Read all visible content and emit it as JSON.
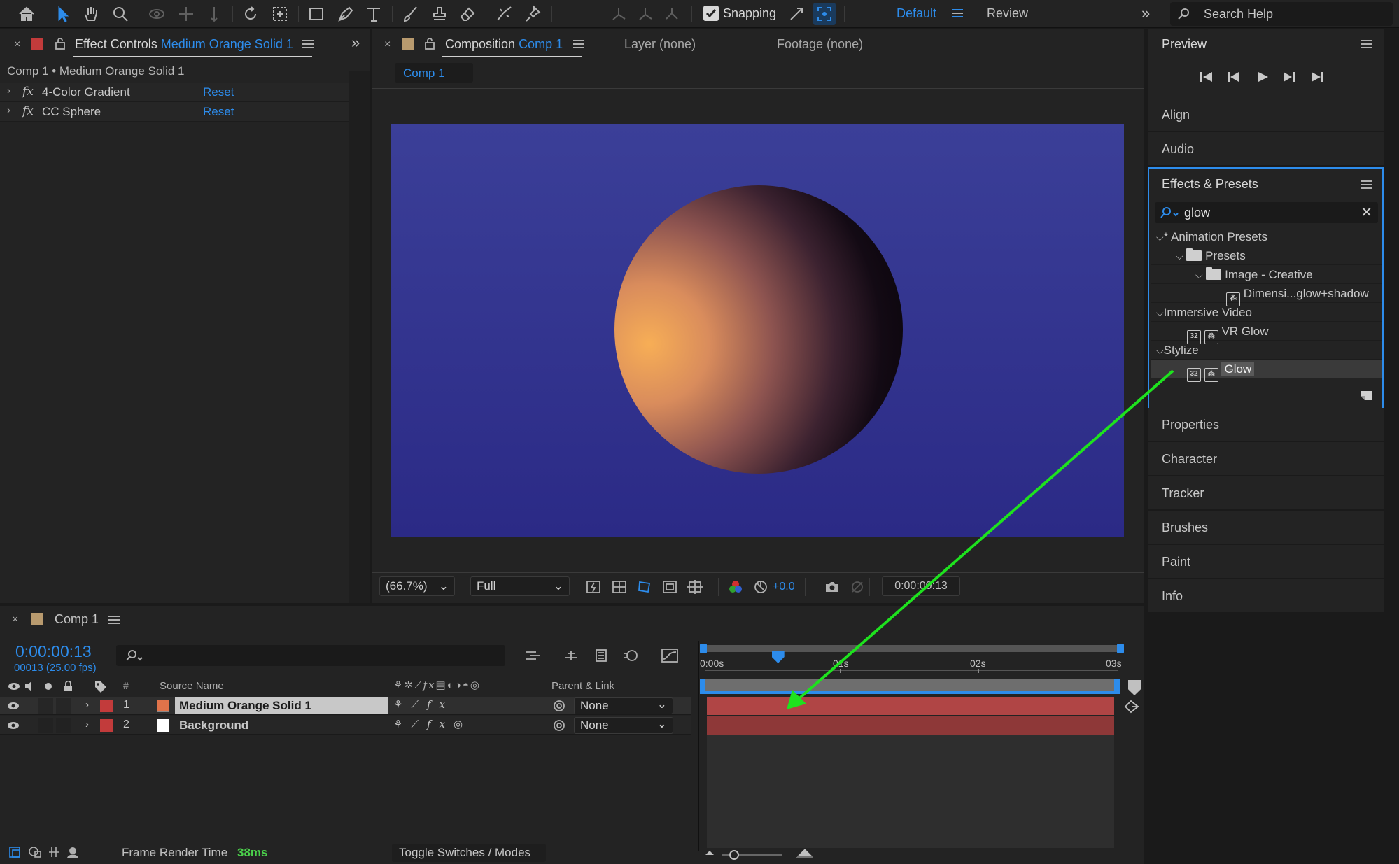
{
  "toolbar": {
    "snapping_label": "Snapping",
    "workspace_default": "Default",
    "workspace_review": "Review",
    "search_placeholder": "Search Help"
  },
  "effect_controls": {
    "tab_prefix": "Effect Controls",
    "tab_layer": "Medium Orange Solid 1",
    "breadcrumb": "Comp 1 • Medium Orange Solid 1",
    "effects": [
      {
        "name": "4-Color Gradient",
        "reset": "Reset"
      },
      {
        "name": "CC Sphere",
        "reset": "Reset"
      }
    ]
  },
  "composition": {
    "tab_prefix": "Composition",
    "tab_name": "Comp 1",
    "layer_tab": "Layer (none)",
    "footage_tab": "Footage (none)",
    "sub_tab": "Comp 1",
    "zoom": "(66.7%)",
    "resolution": "Full",
    "exposure": "+0.0",
    "timecode": "0:00:00:13",
    "colors": {
      "bg_top": "#3b3f98",
      "bg_bottom": "#2b2a86"
    }
  },
  "right_panels": {
    "preview": "Preview",
    "align": "Align",
    "audio": "Audio",
    "effects_presets": "Effects & Presets",
    "search_value": "glow",
    "tree": [
      {
        "label": "* Animation Presets",
        "level": 0,
        "kind": "group"
      },
      {
        "label": "Presets",
        "level": 1,
        "kind": "folder"
      },
      {
        "label": "Image - Creative",
        "level": 2,
        "kind": "folder"
      },
      {
        "label": "Dimensi...glow+shadow",
        "level": 3,
        "kind": "preset"
      },
      {
        "label": "Immersive Video",
        "level": 0,
        "kind": "group"
      },
      {
        "label": "VR Glow",
        "level": 1,
        "kind": "effect"
      },
      {
        "label": "Stylize",
        "level": 0,
        "kind": "group"
      },
      {
        "label": "Glow",
        "level": 1,
        "kind": "effect",
        "selected": true
      }
    ],
    "properties": "Properties",
    "character": "Character",
    "tracker": "Tracker",
    "brushes": "Brushes",
    "paint": "Paint",
    "info": "Info"
  },
  "timeline": {
    "tab": "Comp 1",
    "timecode": "0:00:00:13",
    "frame_info": "00013 (25.00 fps)",
    "col_hash": "#",
    "col_source": "Source Name",
    "col_parent": "Parent & Link",
    "ruler": [
      "0:00s",
      "01s",
      "02s",
      "03s"
    ],
    "layers": [
      {
        "num": "1",
        "name": "Medium Orange Solid 1",
        "parent": "None",
        "color": "#e0734a",
        "label_color": "#c23b3b",
        "selected": true
      },
      {
        "num": "2",
        "name": "Background",
        "parent": "None",
        "color": "#ffffff",
        "label_color": "#c23b3b",
        "selected": false
      }
    ],
    "footer_label": "Frame Render Time",
    "footer_value": "38ms",
    "toggle_label": "Toggle Switches / Modes",
    "playhead_fraction": 0.173
  },
  "annotation": {
    "arrow_color": "#1ee21e"
  }
}
